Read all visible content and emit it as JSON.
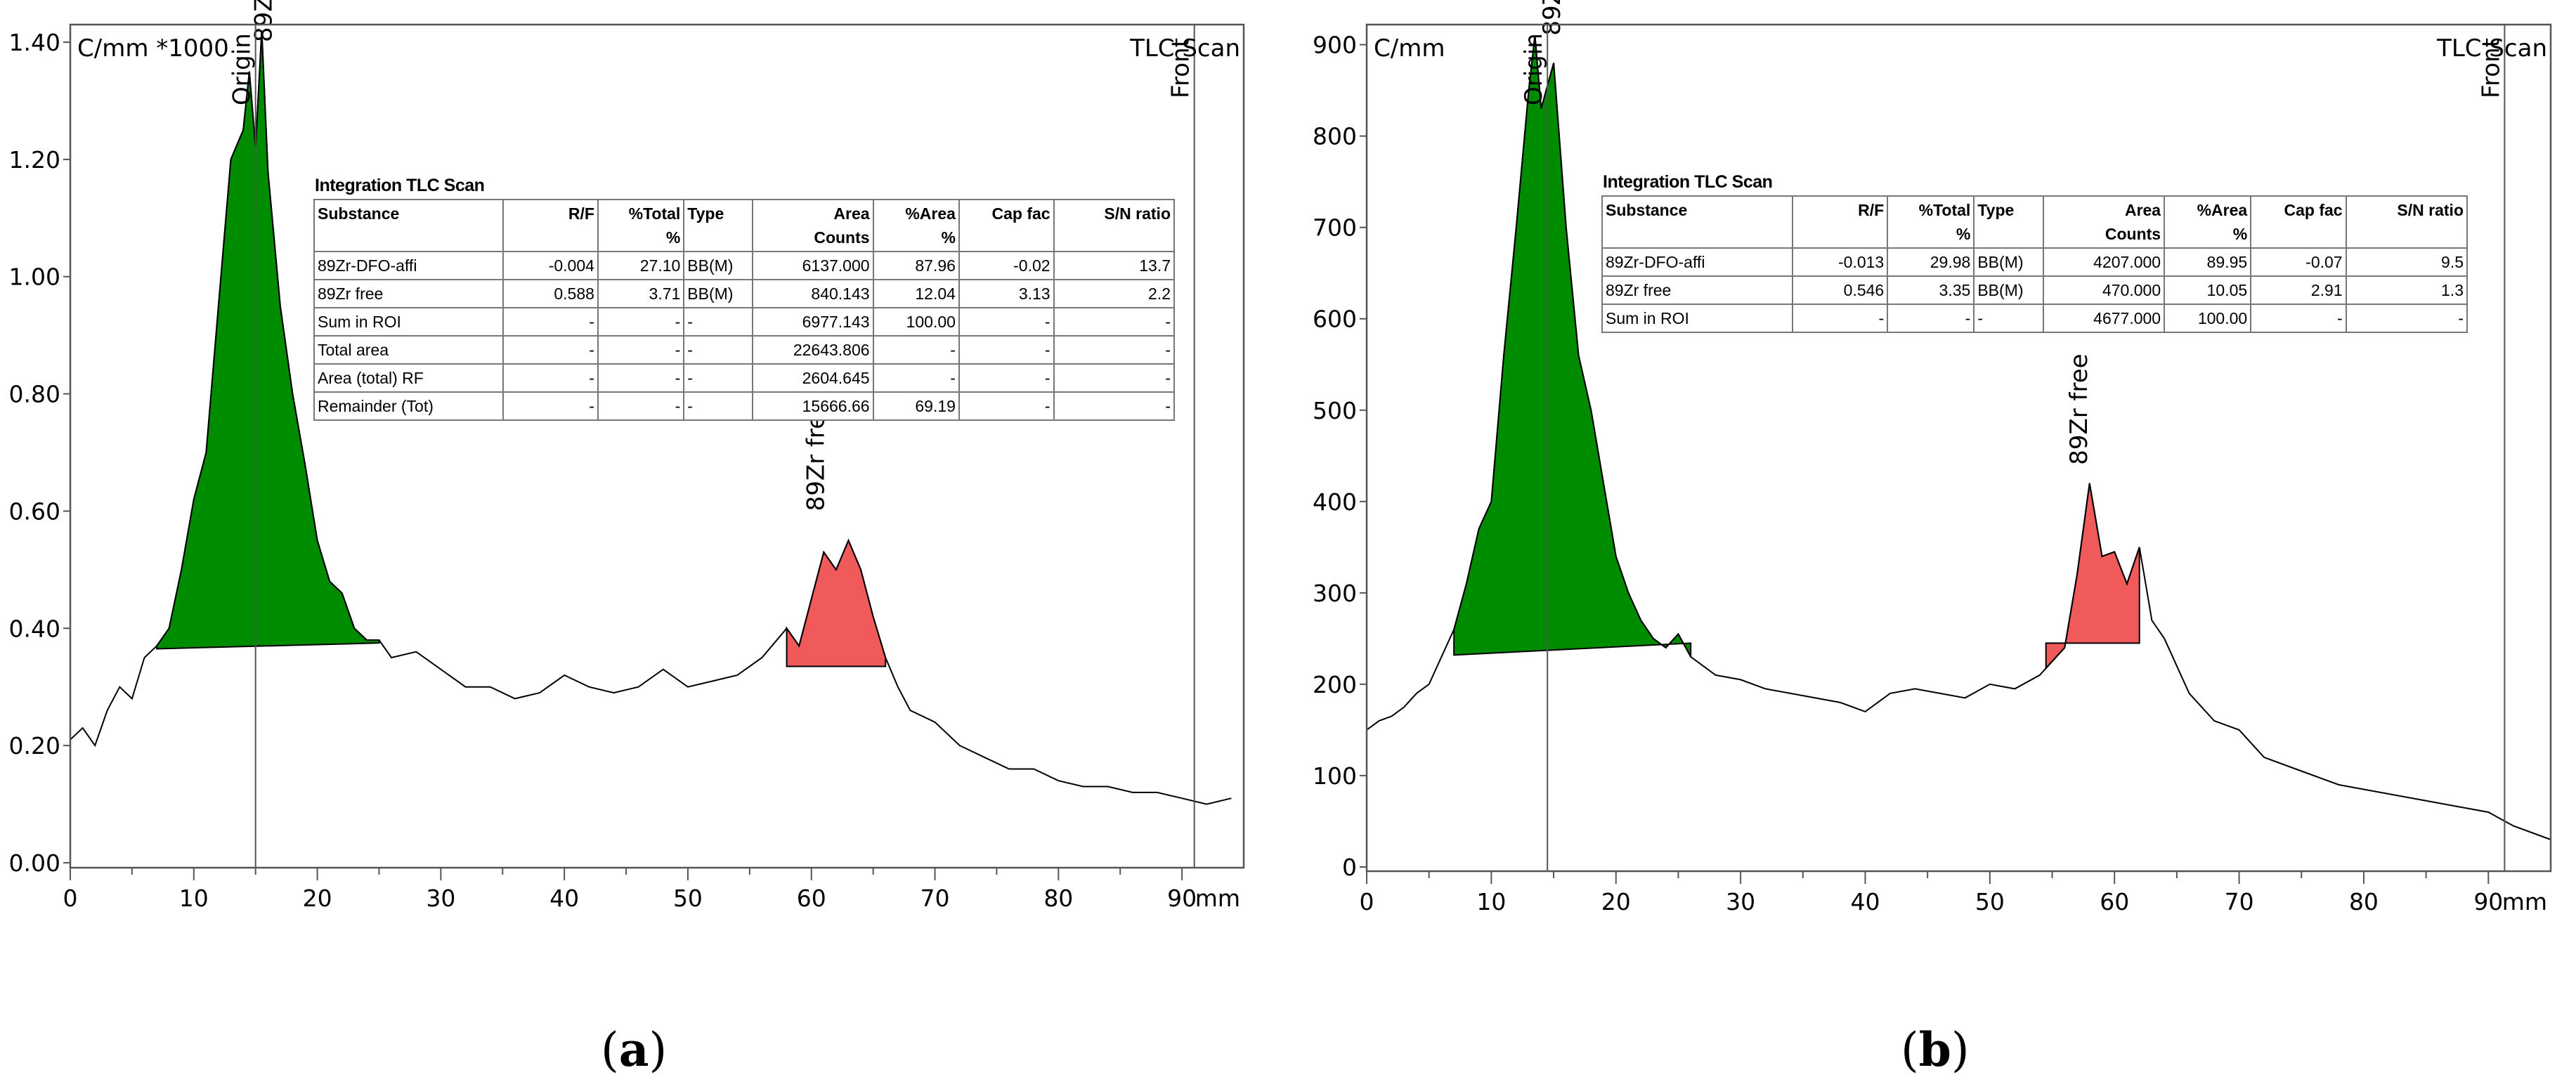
{
  "chart_data": [
    {
      "type": "line",
      "panel": "a",
      "ylabel": "C/mm *1000",
      "xlabel": "mm",
      "xlim": [
        0,
        95
      ],
      "ylim": [
        0,
        1.43
      ],
      "xticks": [
        0,
        10,
        20,
        30,
        40,
        50,
        60,
        70,
        80,
        90
      ],
      "yticks": [
        "0.00",
        "0.20",
        "0.40",
        "0.60",
        "0.80",
        "1.00",
        "1.20",
        "1.40"
      ],
      "x": [
        0,
        1,
        2,
        3,
        4,
        5,
        6,
        7,
        8,
        9,
        10,
        11,
        12,
        13,
        14,
        14.5,
        15,
        15.5,
        16,
        17,
        18,
        19,
        20,
        21,
        22,
        23,
        24,
        25,
        26,
        28,
        30,
        32,
        34,
        36,
        38,
        40,
        42,
        44,
        46,
        48,
        50,
        52,
        54,
        56,
        58,
        59,
        60,
        61,
        62,
        63,
        64,
        65,
        66,
        67,
        68,
        70,
        72,
        74,
        76,
        78,
        80,
        82,
        84,
        86,
        88,
        90,
        92,
        94
      ],
      "y": [
        0.21,
        0.23,
        0.2,
        0.26,
        0.3,
        0.28,
        0.35,
        0.37,
        0.4,
        0.5,
        0.62,
        0.7,
        0.95,
        1.2,
        1.25,
        1.35,
        1.22,
        1.42,
        1.18,
        0.95,
        0.8,
        0.68,
        0.55,
        0.48,
        0.46,
        0.4,
        0.38,
        0.38,
        0.35,
        0.36,
        0.33,
        0.3,
        0.3,
        0.28,
        0.29,
        0.32,
        0.3,
        0.29,
        0.3,
        0.33,
        0.3,
        0.31,
        0.32,
        0.35,
        0.4,
        0.37,
        0.45,
        0.53,
        0.5,
        0.55,
        0.5,
        0.42,
        0.35,
        0.3,
        0.26,
        0.24,
        0.2,
        0.18,
        0.16,
        0.16,
        0.14,
        0.13,
        0.13,
        0.12,
        0.12,
        0.11,
        0.1,
        0.11
      ],
      "peaks": [
        {
          "label": "89Zr-DFO-affi",
          "range": [
            7,
            25
          ],
          "baseline": [
            0.365,
            0.375
          ],
          "color": "#008c00",
          "label_x": 16.3,
          "label_y": 1.4
        },
        {
          "label": "89Zr free",
          "range": [
            58,
            66
          ],
          "baseline": [
            0.335,
            0.335
          ],
          "color": "#f05a5a",
          "label_x": 61,
          "label_y": 0.6
        }
      ],
      "markers": [
        {
          "label": "Origin",
          "x": 15
        },
        {
          "label": "Front",
          "x": 91
        }
      ],
      "corner_label": "TLC Scan",
      "table": {
        "title": "Integration TLC Scan",
        "headers": [
          [
            "Substance",
            ""
          ],
          [
            "R/F",
            ""
          ],
          [
            "%Total",
            "%"
          ],
          [
            "Type",
            ""
          ],
          [
            "Area",
            "Counts"
          ],
          [
            "%Area",
            "%"
          ],
          [
            "Cap fac",
            ""
          ],
          [
            "S/N ratio",
            ""
          ]
        ],
        "rows": [
          [
            "89Zr-DFO-affi",
            "-0.004",
            "27.10",
            "BB(M)",
            "6137.000",
            "87.96",
            "-0.02",
            "13.7"
          ],
          [
            "89Zr free",
            "0.588",
            "3.71",
            "BB(M)",
            "840.143",
            "12.04",
            "3.13",
            "2.2"
          ],
          [
            "Sum in ROI",
            "-",
            "-",
            "-",
            "6977.143",
            "100.00",
            "-",
            "-"
          ],
          [
            "Total area",
            "-",
            "-",
            "-",
            "22643.806",
            "-",
            "-",
            "-"
          ],
          [
            "Area (total) RF",
            "-",
            "-",
            "-",
            "2604.645",
            "-",
            "-",
            "-"
          ],
          [
            "Remainder (Tot)",
            "-",
            "-",
            "-",
            "15666.66",
            "69.19",
            "-",
            "-"
          ]
        ]
      },
      "caption": "a"
    },
    {
      "type": "line",
      "panel": "b",
      "ylabel": "C/mm",
      "xlabel": "mm",
      "xlim": [
        0,
        95
      ],
      "ylim": [
        0,
        922
      ],
      "xticks": [
        0,
        10,
        20,
        30,
        40,
        50,
        60,
        70,
        80,
        90
      ],
      "yticks": [
        "0",
        "100",
        "200",
        "300",
        "400",
        "500",
        "600",
        "700",
        "800",
        "900"
      ],
      "x": [
        0,
        1,
        2,
        3,
        4,
        5,
        6,
        7,
        8,
        9,
        10,
        11,
        12,
        13,
        13.5,
        14,
        15,
        16,
        17,
        18,
        19,
        20,
        21,
        22,
        23,
        24,
        25,
        26,
        28,
        30,
        32,
        34,
        36,
        38,
        40,
        42,
        44,
        46,
        48,
        50,
        52,
        54,
        56,
        57,
        58,
        59,
        60,
        61,
        62,
        63,
        64,
        66,
        68,
        70,
        72,
        74,
        76,
        78,
        80,
        82,
        84,
        86,
        88,
        90,
        92,
        94,
        95
      ],
      "y": [
        150,
        160,
        165,
        175,
        190,
        200,
        230,
        260,
        310,
        370,
        400,
        560,
        700,
        850,
        910,
        830,
        880,
        700,
        560,
        500,
        420,
        340,
        300,
        270,
        250,
        240,
        255,
        230,
        210,
        205,
        195,
        190,
        185,
        180,
        170,
        190,
        195,
        190,
        185,
        200,
        195,
        210,
        240,
        320,
        420,
        340,
        345,
        310,
        350,
        270,
        250,
        190,
        160,
        150,
        120,
        110,
        100,
        90,
        85,
        80,
        75,
        70,
        65,
        60,
        45,
        35,
        30
      ],
      "peaks": [
        {
          "label": "89Zr-DFO-affi",
          "range": [
            7,
            26
          ],
          "baseline": [
            232,
            245
          ],
          "color": "#008c00",
          "label_x": 15.5,
          "label_y": 910
        },
        {
          "label": "89Zr free",
          "range": [
            54.5,
            62
          ],
          "baseline": [
            245,
            245
          ],
          "color": "#f05a5a",
          "label_x": 57.8,
          "label_y": 440
        }
      ],
      "markers": [
        {
          "label": "Origin",
          "x": 14.5
        },
        {
          "label": "Front",
          "x": 91.3
        }
      ],
      "corner_label": "TLC Scan",
      "table": {
        "title": "Integration TLC Scan",
        "headers": [
          [
            "Substance",
            ""
          ],
          [
            "R/F",
            ""
          ],
          [
            "%Total",
            "%"
          ],
          [
            "Type",
            ""
          ],
          [
            "Area",
            "Counts"
          ],
          [
            "%Area",
            "%"
          ],
          [
            "Cap fac",
            ""
          ],
          [
            "S/N ratio",
            ""
          ]
        ],
        "rows": [
          [
            "89Zr-DFO-affi",
            "-0.013",
            "29.98",
            "BB(M)",
            "4207.000",
            "89.95",
            "-0.07",
            "9.5"
          ],
          [
            "89Zr free",
            "0.546",
            "3.35",
            "BB(M)",
            "470.000",
            "10.05",
            "2.91",
            "1.3"
          ],
          [
            "Sum in ROI",
            "-",
            "-",
            "-",
            "4677.000",
            "100.00",
            "-",
            "-"
          ]
        ]
      },
      "caption": "b"
    }
  ]
}
